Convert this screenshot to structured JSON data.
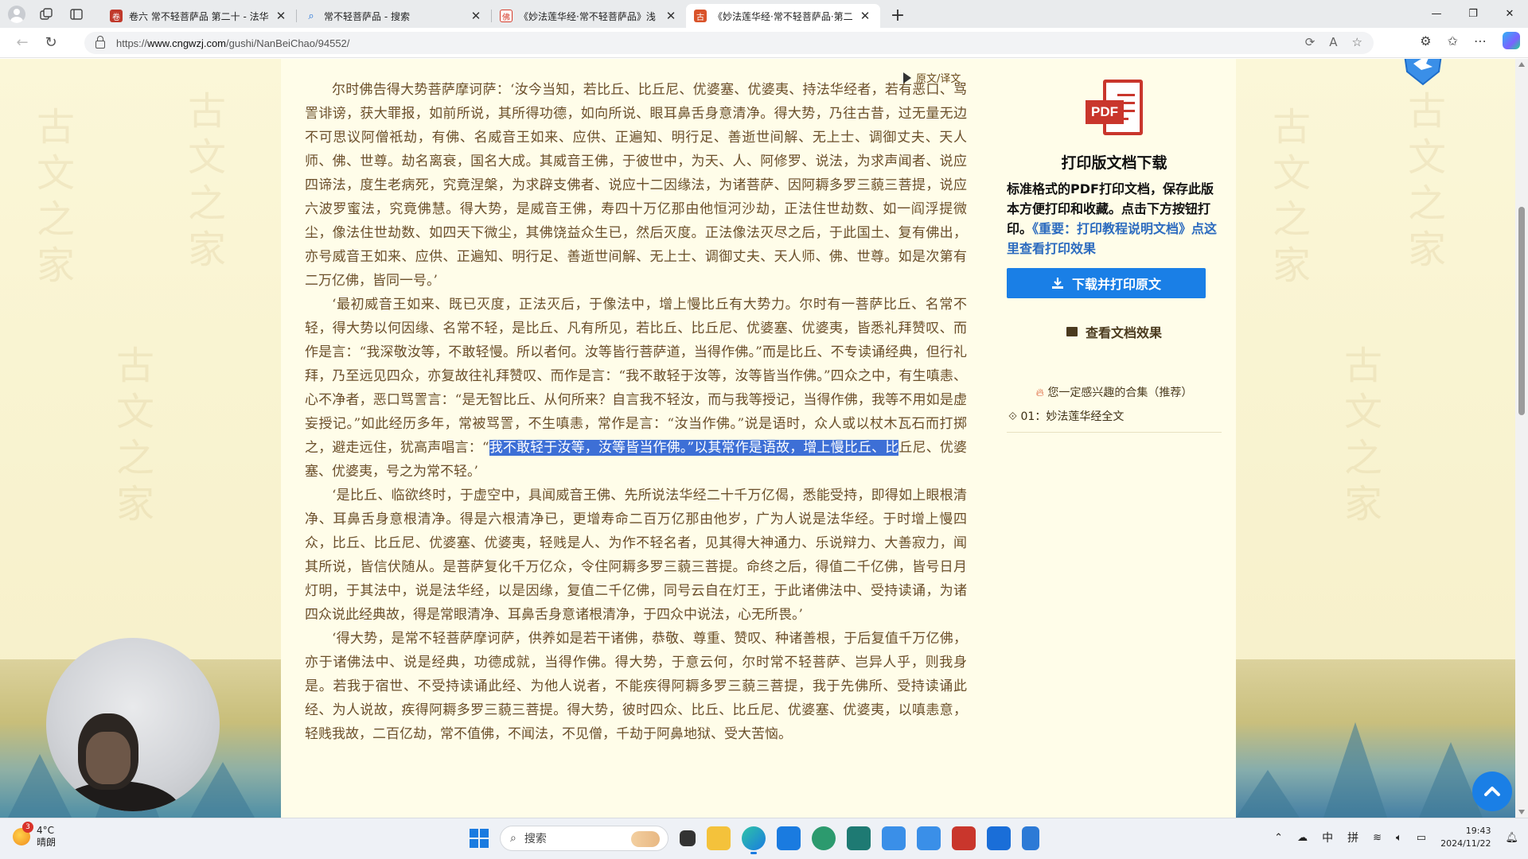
{
  "browser": {
    "tabs": [
      {
        "title": "卷六 常不轻菩萨品 第二十 - 法华",
        "favicon_color": "#c0392b",
        "favicon_glyph": "卷",
        "active": false
      },
      {
        "title": "常不轻菩萨品 - 搜索",
        "favicon_color": "#1a6ed8",
        "favicon_glyph": "⌕",
        "active": false
      },
      {
        "title": "《妙法莲华经·常不轻菩萨品》浅",
        "favicon_color": "#d63b2a",
        "favicon_glyph": "佛",
        "active": false
      },
      {
        "title": "《妙法莲华经·常不轻菩萨品·第二",
        "favicon_color": "#d9532a",
        "favicon_glyph": "古",
        "active": true
      }
    ],
    "new_tab_label": "+",
    "window_controls": {
      "minimize": "—",
      "restore": "❐",
      "close": "✕"
    },
    "url": {
      "prefix": "https://",
      "host": "www.cngwzj.com",
      "path": "/gushi/NanBeiChao/94552/"
    }
  },
  "article": {
    "toggle_label": "原文/译文",
    "paragraphs": [
      "尔时佛告得大势菩萨摩诃萨：‘汝今当知，若比丘、比丘尼、优婆塞、优婆夷、持法华经者，若有恶口、骂詈诽谤，获大罪报，如前所说，其所得功德，如向所说、眼耳鼻舌身意清净。得大势，乃往古昔，过无量无边不可思议阿僧祇劫，有佛、名威音王如来、应供、正遍知、明行足、善逝世间解、无上士、调御丈夫、天人师、佛、世尊。劫名离衰，国名大成。其威音王佛，于彼世中，为天、人、阿修罗、说法，为求声闻者、说应四谛法，度生老病死，究竟涅槃，为求辟支佛者、说应十二因缘法，为诸菩萨、因阿耨多罗三藐三菩提，说应六波罗蜜法，究竟佛慧。得大势，是威音王佛，寿四十万亿那由他恒河沙劫，正法住世劫数、如一阎浮提微尘，像法住世劫数、如四天下微尘，其佛饶益众生已，然后灭度。正法像法灭尽之后，于此国土、复有佛出，亦号威音王如来、应供、正遍知、明行足、善逝世间解、无上士、调御丈夫、天人师、佛、世尊。如是次第有二万亿佛，皆同一号。’"
    ],
    "p2_before": "‘最初威音王如来、既已灭度，正法灭后，于像法中，增上慢比丘有大势力。尔时有一菩萨比丘、名常不轻，得大势以何因缘、名常不轻，是比丘、凡有所见，若比丘、比丘尼、优婆塞、优婆夷，皆悉礼拜赞叹、而作是言：“我深敬汝等，不敢轻慢。所以者何。汝等皆行菩萨道，当得作佛。”而是比丘、不专读诵经典，但行礼拜，乃至远见四众，亦复故往礼拜赞叹、而作是言：“我不敢轻于汝等，汝等皆当作佛。”四众之中，有生嗔恚、心不净者，恶口骂詈言：“是无智比丘、从何所来？自言我不轻汝，而与我等授记，当得作佛，我等不用如是虚妄授记。”如此经历多年，常被骂詈，不生嗔恚，常作是言：“汝当作佛。”说是语时，众人或以杖木瓦石而打掷之，避走远住，犹高声唱言：“",
    "p2_selected": "我不敢轻于汝等，汝等皆当作佛。”以其常作是语故，增上慢比丘、比",
    "p2_after": "丘尼、优婆塞、优婆夷，号之为常不轻。’",
    "paragraphs_after": [
      "‘是比丘、临欲终时，于虚空中，具闻威音王佛、先所说法华经二十千万亿偈，悉能受持，即得如上眼根清净、耳鼻舌身意根清净。得是六根清净已，更增寿命二百万亿那由他岁，广为人说是法华经。于时增上慢四众，比丘、比丘尼、优婆塞、优婆夷，轻贱是人、为作不轻名者，见其得大神通力、乐说辩力、大善寂力，闻其所说，皆信伏随从。是菩萨复化千万亿众，令住阿耨多罗三藐三菩提。命终之后，得值二千亿佛，皆号日月灯明，于其法中，说是法华经，以是因缘，复值二千亿佛，同号云自在灯王，于此诸佛法中、受持读诵，为诸四众说此经典故，得是常眼清净、耳鼻舌身意诸根清净，于四众中说法，心无所畏。’",
      "‘得大势，是常不轻菩萨摩诃萨，供养如是若干诸佛，恭敬、尊重、赞叹、种诸善根，于后复值千万亿佛，亦于诸佛法中、说是经典，功德成就，当得作佛。得大势，于意云何，尔时常不轻菩萨、岂异人乎，则我身是。若我于宿世、不受持读诵此经、为他人说者，不能疾得阿耨多罗三藐三菩提，我于先佛所、受持读诵此经、为人说故，疾得阿耨多罗三藐三菩提。得大势，彼时四众、比丘、比丘尼、优婆塞、优婆夷，以嗔恚意，轻贱我故，二百亿劫，常不值佛，不闻法，不见僧，千劫于阿鼻地狱、受大苦恼。"
    ]
  },
  "sidebar": {
    "pdf_label": "PDF",
    "title": "打印版文档下载",
    "desc_text": "标准格式的PDF打印文档，保存此版本方便打印和收藏。点击下方按钮打印。",
    "desc_link": "《重要：打印教程说明文档》点这里查看打印效果",
    "download_button": "下载并打印原文",
    "view_effect": "查看文档效果",
    "recommend_title": "您一定感兴趣的合集（推荐）",
    "recommend_item": "01：妙法莲华经全文"
  },
  "watermark": "古文之家",
  "taskbar": {
    "weather_badge": "3",
    "temperature": "4°C",
    "condition": "晴朗",
    "search_placeholder": "搜索",
    "ime_lang": "中",
    "ime_mode": "拼",
    "time": "19:43",
    "date": "2024/11/22"
  },
  "colors": {
    "accent_blue": "#1a7fe6",
    "text_brown": "#6b4f2a",
    "selection": "#3d6fd6",
    "page_bg": "#fffde9",
    "pdf_red": "#c9362c"
  }
}
